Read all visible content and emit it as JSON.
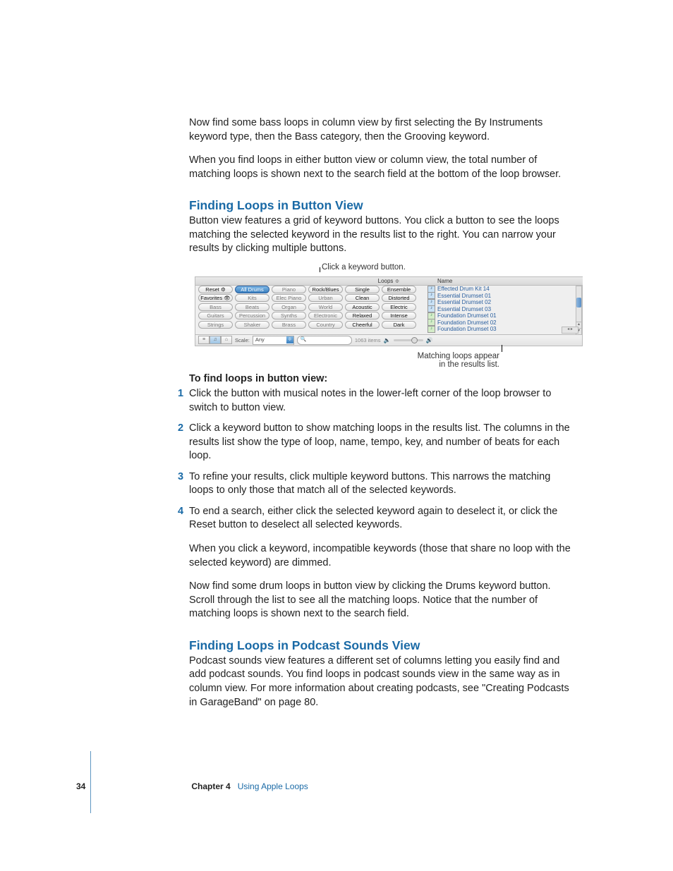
{
  "para_intro1": "Now find some bass loops in column view by first selecting the By Instruments keyword type, then the Bass category, then the Grooving keyword.",
  "para_intro2": "When you find loops in either button view or column view, the total number of matching loops is shown next to the search field at the bottom of the loop browser.",
  "h_button": "Finding Loops in Button View",
  "para_button": "Button view features a grid of keyword buttons. You click a button to see the loops matching the selected keyword in the results list to the right. You can narrow your results by clicking multiple buttons.",
  "callout_top": "Click a keyword button.",
  "callout_bottom1": "Matching loops appear",
  "callout_bottom2": "in the results list.",
  "bold_steps": "To find loops in button view:",
  "steps": [
    "Click the button with musical notes in the lower-left corner of the loop browser to switch to button view.",
    "Click a keyword button to show matching loops in the results list. The columns in the results list show the type of loop, name, tempo, key, and number of beats for each loop.",
    "To refine your results, click multiple keyword buttons. This narrows the matching loops to only those that match all of the selected keywords.",
    "To end a search, either click the selected keyword again to deselect it, or click the Reset button to deselect all selected keywords."
  ],
  "para_after1": "When you click a keyword, incompatible keywords (those that share no loop with the selected keyword) are dimmed.",
  "para_after2": "Now find some drum loops in button view by clicking the Drums keyword button. Scroll through the list to see all the matching loops. Notice that the number of matching loops is shown next to the search field.",
  "h_podcast": "Finding Loops in Podcast Sounds View",
  "para_podcast": "Podcast sounds view features a different set of columns letting you easily find and add podcast sounds. You find loops in podcast sounds view in the same way as in column view. For more information about creating podcasts, see \"Creating Podcasts in GarageBand\" on page 80.",
  "footer": {
    "page": "34",
    "chapter": "Chapter 4",
    "title": "Using Apple Loops"
  },
  "figure": {
    "header": "Loops ≑",
    "name_header": "Name",
    "rows": [
      [
        "Reset ⚙",
        "All Drums",
        "Piano",
        "Rock/Blues",
        "Single",
        "Ensemble"
      ],
      [
        "Favorites 👁",
        "Kits",
        "Elec Piano",
        "Urban",
        "Clean",
        "Distorted"
      ],
      [
        "Bass",
        "Beats",
        "Organ",
        "World",
        "Acoustic",
        "Electric"
      ],
      [
        "Guitars",
        "Percussion",
        "Synths",
        "Electronic",
        "Relaxed",
        "Intense"
      ],
      [
        "Strings",
        "Shaker",
        "Brass",
        "Country",
        "Cheerful",
        "Dark"
      ]
    ],
    "active": [
      "All Drums",
      "Rock/Blues",
      "Single",
      "Ensemble",
      "Clean",
      "Distorted",
      "Acoustic",
      "Electric",
      "Relaxed",
      "Intense",
      "Cheerful",
      "Dark",
      "Reset ⚙",
      "Favorites 👁"
    ],
    "selected": "All Drums",
    "scale_label": "Scale:",
    "scale_value": "Any",
    "items": "1063 items",
    "results": [
      {
        "ico": "b",
        "name": "Effected Drum Kit 14"
      },
      {
        "ico": "b",
        "name": "Essential Drumset 01"
      },
      {
        "ico": "b",
        "name": "Essential Drumset 02"
      },
      {
        "ico": "b",
        "name": "Essential Drumset 03"
      },
      {
        "ico": "g",
        "name": "Foundation Drumset 01"
      },
      {
        "ico": "g",
        "name": "Foundation Drumset 02"
      },
      {
        "ico": "g",
        "name": "Foundation Drumset 03"
      }
    ]
  }
}
